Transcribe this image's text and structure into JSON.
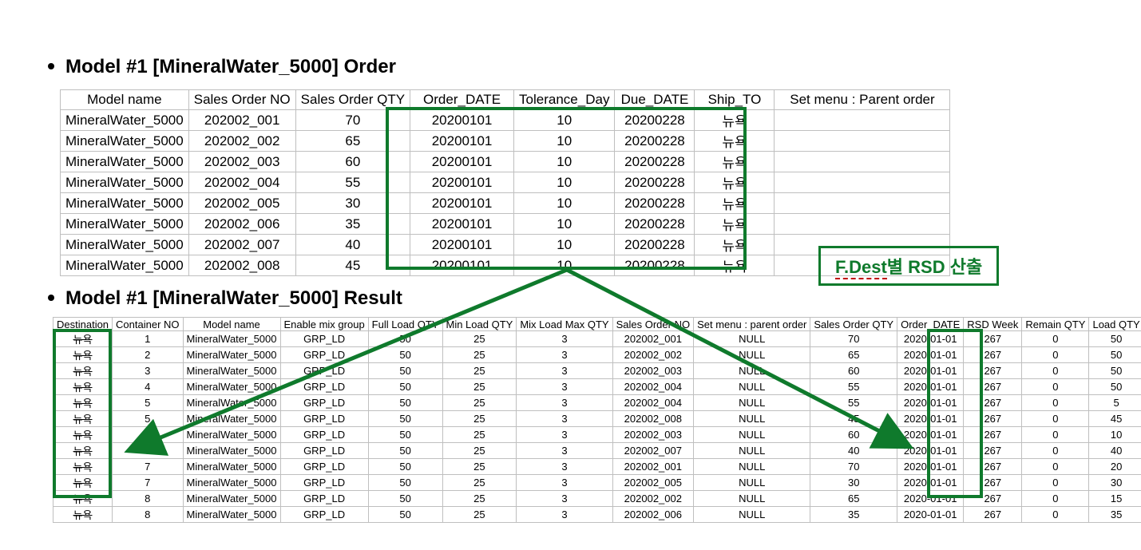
{
  "titles": {
    "order": "Model #1 [MineralWater_5000] Order",
    "result": "Model #1 [MineralWater_5000] Result"
  },
  "callout": {
    "prefix": "F.Dest",
    "suffix": "별 RSD 산출"
  },
  "order_table": {
    "headers": [
      "Model name",
      "Sales Order NO",
      "Sales Order QTY",
      "Order_DATE",
      "Tolerance_Day",
      "Due_DATE",
      "Ship_TO",
      "Set menu : Parent order"
    ],
    "rows": [
      [
        "MineralWater_5000",
        "202002_001",
        "70",
        "20200101",
        "10",
        "20200228",
        "뉴욕",
        ""
      ],
      [
        "MineralWater_5000",
        "202002_002",
        "65",
        "20200101",
        "10",
        "20200228",
        "뉴욕",
        ""
      ],
      [
        "MineralWater_5000",
        "202002_003",
        "60",
        "20200101",
        "10",
        "20200228",
        "뉴욕",
        ""
      ],
      [
        "MineralWater_5000",
        "202002_004",
        "55",
        "20200101",
        "10",
        "20200228",
        "뉴욕",
        ""
      ],
      [
        "MineralWater_5000",
        "202002_005",
        "30",
        "20200101",
        "10",
        "20200228",
        "뉴욕",
        ""
      ],
      [
        "MineralWater_5000",
        "202002_006",
        "35",
        "20200101",
        "10",
        "20200228",
        "뉴욕",
        ""
      ],
      [
        "MineralWater_5000",
        "202002_007",
        "40",
        "20200101",
        "10",
        "20200228",
        "뉴욕",
        ""
      ],
      [
        "MineralWater_5000",
        "202002_008",
        "45",
        "20200101",
        "10",
        "20200228",
        "뉴욕",
        ""
      ]
    ]
  },
  "result_table": {
    "headers": [
      "Destination",
      "Container NO",
      "Model name",
      "Enable mix group",
      "Full Load QTY",
      "Min Load QTY",
      "Mix Load Max QTY",
      "Sales Order NO",
      "Set menu : parent order",
      "Sales Order QTY",
      "Order_DATE",
      "RSD Week",
      "Remain QTY",
      "Load QTY"
    ],
    "rows": [
      [
        "뉴욕",
        "1",
        "MineralWater_5000",
        "GRP_LD",
        "50",
        "25",
        "3",
        "202002_001",
        "NULL",
        "70",
        "2020-01-01",
        "267",
        "0",
        "50"
      ],
      [
        "뉴욕",
        "2",
        "MineralWater_5000",
        "GRP_LD",
        "50",
        "25",
        "3",
        "202002_002",
        "NULL",
        "65",
        "2020-01-01",
        "267",
        "0",
        "50"
      ],
      [
        "뉴욕",
        "3",
        "MineralWater_5000",
        "GRP_LD",
        "50",
        "25",
        "3",
        "202002_003",
        "NULL",
        "60",
        "2020-01-01",
        "267",
        "0",
        "50"
      ],
      [
        "뉴욕",
        "4",
        "MineralWater_5000",
        "GRP_LD",
        "50",
        "25",
        "3",
        "202002_004",
        "NULL",
        "55",
        "2020-01-01",
        "267",
        "0",
        "50"
      ],
      [
        "뉴욕",
        "5",
        "MineralWater_5000",
        "GRP_LD",
        "50",
        "25",
        "3",
        "202002_004",
        "NULL",
        "55",
        "2020-01-01",
        "267",
        "0",
        "5"
      ],
      [
        "뉴욕",
        "5",
        "MineralWater_5000",
        "GRP_LD",
        "50",
        "25",
        "3",
        "202002_008",
        "NULL",
        "45",
        "2020-01-01",
        "267",
        "0",
        "45"
      ],
      [
        "뉴욕",
        "6",
        "MineralWater_5000",
        "GRP_LD",
        "50",
        "25",
        "3",
        "202002_003",
        "NULL",
        "60",
        "2020-01-01",
        "267",
        "0",
        "10"
      ],
      [
        "뉴욕",
        "6",
        "MineralWater_5000",
        "GRP_LD",
        "50",
        "25",
        "3",
        "202002_007",
        "NULL",
        "40",
        "2020-01-01",
        "267",
        "0",
        "40"
      ],
      [
        "뉴욕",
        "7",
        "MineralWater_5000",
        "GRP_LD",
        "50",
        "25",
        "3",
        "202002_001",
        "NULL",
        "70",
        "2020-01-01",
        "267",
        "0",
        "20"
      ],
      [
        "뉴욕",
        "7",
        "MineralWater_5000",
        "GRP_LD",
        "50",
        "25",
        "3",
        "202002_005",
        "NULL",
        "30",
        "2020-01-01",
        "267",
        "0",
        "30"
      ],
      [
        "뉴욕",
        "8",
        "MineralWater_5000",
        "GRP_LD",
        "50",
        "25",
        "3",
        "202002_002",
        "NULL",
        "65",
        "2020-01-01",
        "267",
        "0",
        "15"
      ],
      [
        "뉴욕",
        "8",
        "MineralWater_5000",
        "GRP_LD",
        "50",
        "25",
        "3",
        "202002_006",
        "NULL",
        "35",
        "2020-01-01",
        "267",
        "0",
        "35"
      ]
    ]
  },
  "chart_data": [
    {
      "type": "table",
      "title": "Model #1 [MineralWater_5000] Order",
      "columns": [
        "Model name",
        "Sales Order NO",
        "Sales Order QTY",
        "Order_DATE",
        "Tolerance_Day",
        "Due_DATE",
        "Ship_TO",
        "Set menu : Parent order"
      ],
      "data": [
        [
          "MineralWater_5000",
          "202002_001",
          70,
          "20200101",
          10,
          "20200228",
          "뉴욕",
          null
        ],
        [
          "MineralWater_5000",
          "202002_002",
          65,
          "20200101",
          10,
          "20200228",
          "뉴욕",
          null
        ],
        [
          "MineralWater_5000",
          "202002_003",
          60,
          "20200101",
          10,
          "20200228",
          "뉴욕",
          null
        ],
        [
          "MineralWater_5000",
          "202002_004",
          55,
          "20200101",
          10,
          "20200228",
          "뉴욕",
          null
        ],
        [
          "MineralWater_5000",
          "202002_005",
          30,
          "20200101",
          10,
          "20200228",
          "뉴욕",
          null
        ],
        [
          "MineralWater_5000",
          "202002_006",
          35,
          "20200101",
          10,
          "20200228",
          "뉴욕",
          null
        ],
        [
          "MineralWater_5000",
          "202002_007",
          40,
          "20200101",
          10,
          "20200228",
          "뉴욕",
          null
        ],
        [
          "MineralWater_5000",
          "202002_008",
          45,
          "20200101",
          10,
          "20200228",
          "뉴욕",
          null
        ]
      ]
    },
    {
      "type": "table",
      "title": "Model #1 [MineralWater_5000] Result",
      "columns": [
        "Destination",
        "Container NO",
        "Model name",
        "Enable mix group",
        "Full Load QTY",
        "Min Load QTY",
        "Mix Load Max QTY",
        "Sales Order NO",
        "Set menu : parent order",
        "Sales Order QTY",
        "Order_DATE",
        "RSD Week",
        "Remain QTY",
        "Load QTY"
      ],
      "data": [
        [
          "뉴욕",
          1,
          "MineralWater_5000",
          "GRP_LD",
          50,
          25,
          3,
          "202002_001",
          "NULL",
          70,
          "2020-01-01",
          267,
          0,
          50
        ],
        [
          "뉴욕",
          2,
          "MineralWater_5000",
          "GRP_LD",
          50,
          25,
          3,
          "202002_002",
          "NULL",
          65,
          "2020-01-01",
          267,
          0,
          50
        ],
        [
          "뉴욕",
          3,
          "MineralWater_5000",
          "GRP_LD",
          50,
          25,
          3,
          "202002_003",
          "NULL",
          60,
          "2020-01-01",
          267,
          0,
          50
        ],
        [
          "뉴욕",
          4,
          "MineralWater_5000",
          "GRP_LD",
          50,
          25,
          3,
          "202002_004",
          "NULL",
          55,
          "2020-01-01",
          267,
          0,
          50
        ],
        [
          "뉴욕",
          5,
          "MineralWater_5000",
          "GRP_LD",
          50,
          25,
          3,
          "202002_004",
          "NULL",
          55,
          "2020-01-01",
          267,
          0,
          5
        ],
        [
          "뉴욕",
          5,
          "MineralWater_5000",
          "GRP_LD",
          50,
          25,
          3,
          "202002_008",
          "NULL",
          45,
          "2020-01-01",
          267,
          0,
          45
        ],
        [
          "뉴욕",
          6,
          "MineralWater_5000",
          "GRP_LD",
          50,
          25,
          3,
          "202002_003",
          "NULL",
          60,
          "2020-01-01",
          267,
          0,
          10
        ],
        [
          "뉴욕",
          6,
          "MineralWater_5000",
          "GRP_LD",
          50,
          25,
          3,
          "202002_007",
          "NULL",
          40,
          "2020-01-01",
          267,
          0,
          40
        ],
        [
          "뉴욕",
          7,
          "MineralWater_5000",
          "GRP_LD",
          50,
          25,
          3,
          "202002_001",
          "NULL",
          70,
          "2020-01-01",
          267,
          0,
          20
        ],
        [
          "뉴욕",
          7,
          "MineralWater_5000",
          "GRP_LD",
          50,
          25,
          3,
          "202002_005",
          "NULL",
          30,
          "2020-01-01",
          267,
          0,
          30
        ],
        [
          "뉴욕",
          8,
          "MineralWater_5000",
          "GRP_LD",
          50,
          25,
          3,
          "202002_002",
          "NULL",
          65,
          "2020-01-01",
          267,
          0,
          15
        ],
        [
          "뉴욕",
          8,
          "MineralWater_5000",
          "GRP_LD",
          50,
          25,
          3,
          "202002_006",
          "NULL",
          35,
          "2020-01-01",
          267,
          0,
          35
        ]
      ]
    }
  ]
}
